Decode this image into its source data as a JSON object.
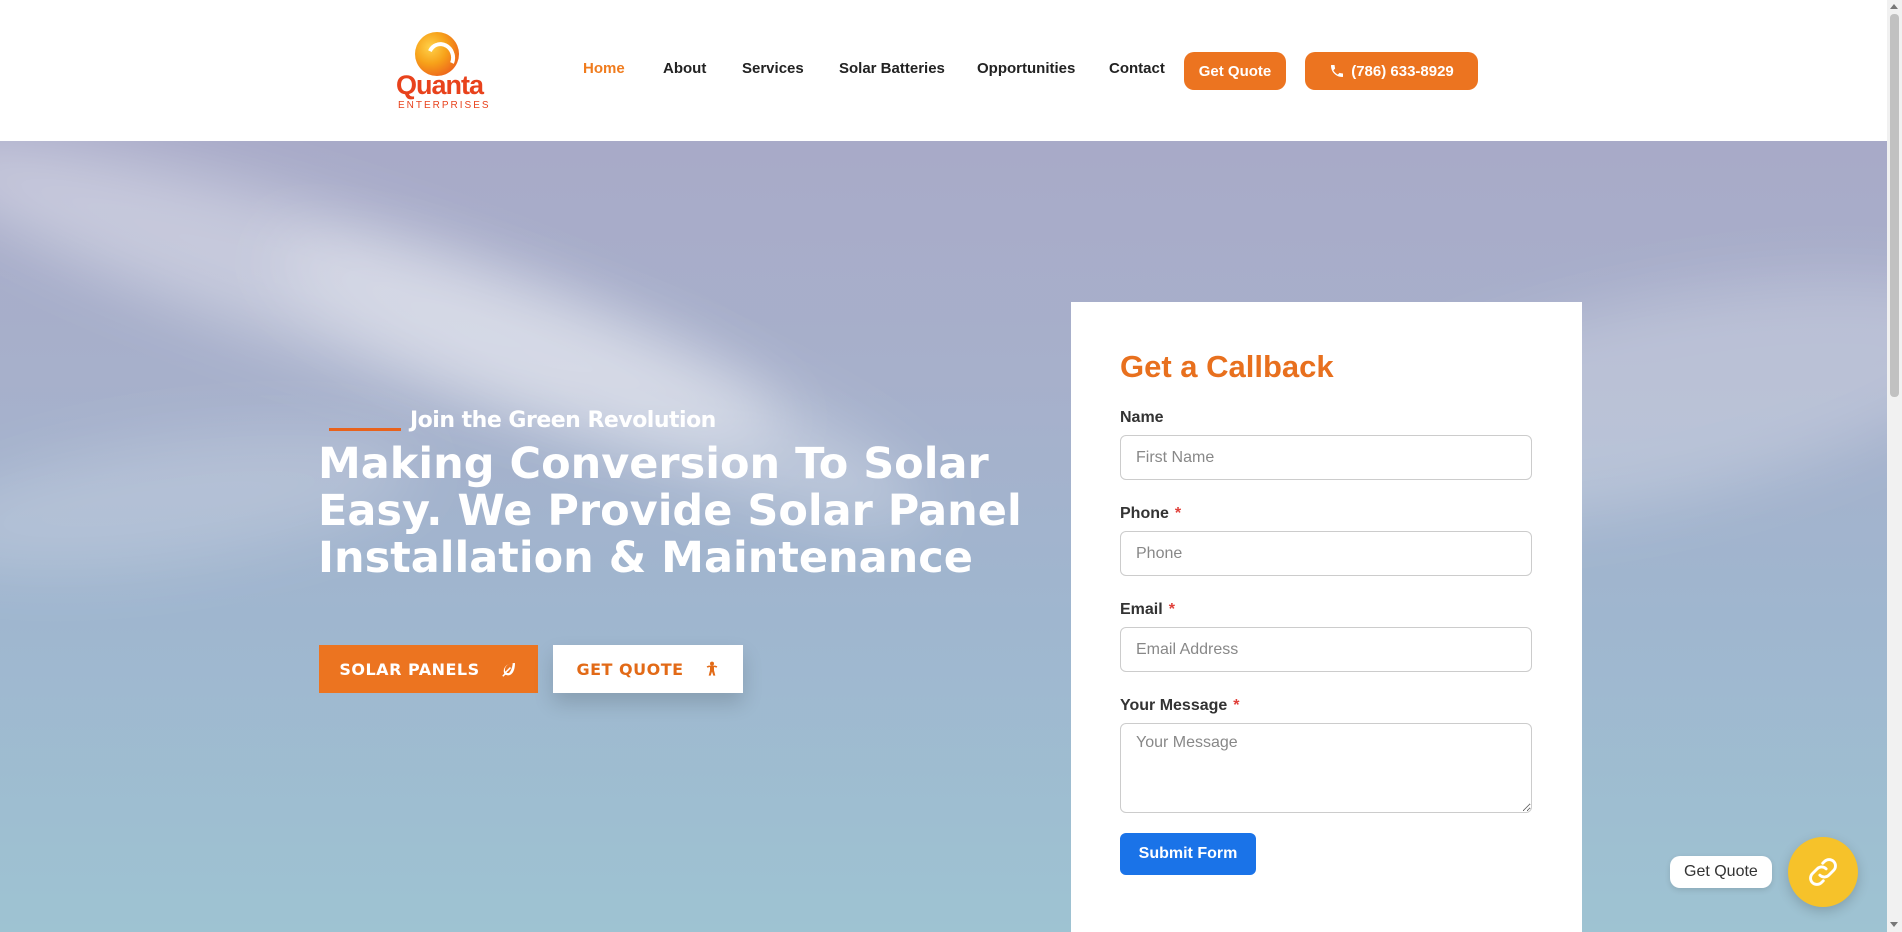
{
  "brand": {
    "name": "Quanta",
    "tagline": "ENTERPRISES",
    "icon": "quanta-logo"
  },
  "nav": {
    "items": [
      {
        "label": "Home",
        "active": true
      },
      {
        "label": "About"
      },
      {
        "label": "Services"
      },
      {
        "label": "Solar Batteries"
      },
      {
        "label": "Opportunities"
      },
      {
        "label": "Contact"
      }
    ],
    "quote_button": "Get Quote",
    "phone_button": "(786) 633-8929",
    "phone_icon": "phone-icon"
  },
  "hero": {
    "kicker": "Join the Green Revolution",
    "headline": "Making Conversion To Solar Easy. We Provide Solar Panel Installation & Maintenance",
    "primary_button": "SOLAR PANELS",
    "primary_icon": "leaf-icon",
    "secondary_button": "GET QUOTE",
    "secondary_icon": "person-icon"
  },
  "callback_form": {
    "title": "Get a Callback",
    "fields": [
      {
        "label": "Name",
        "required": false,
        "placeholder": "First Name"
      },
      {
        "label": "Phone",
        "required": true,
        "placeholder": "Phone"
      },
      {
        "label": "Email",
        "required": true,
        "placeholder": "Email Address"
      },
      {
        "label": "Your Message",
        "required": true,
        "placeholder": "Your Message"
      }
    ],
    "required_marker": "*",
    "submit_label": "Submit Form"
  },
  "floating_widget": {
    "label": "Get Quote",
    "icon": "link-icon"
  },
  "colors": {
    "accent": "#ec7420",
    "nav_active": "#f07c1e",
    "submit": "#1a73e8",
    "widget": "#f6c22a"
  }
}
